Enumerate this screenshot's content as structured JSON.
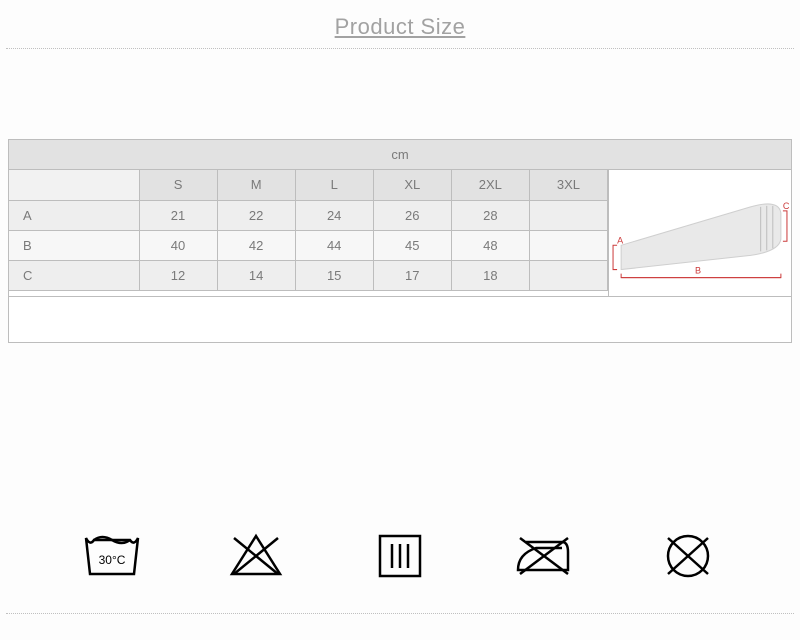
{
  "title": "Product Size",
  "unit": "cm",
  "chart_data": {
    "type": "table",
    "title": "Product Size (cm)",
    "columns": [
      "S",
      "M",
      "L",
      "XL",
      "2XL",
      "3XL"
    ],
    "rows": [
      {
        "label": "A",
        "values": [
          "21",
          "22",
          "24",
          "26",
          "28",
          ""
        ]
      },
      {
        "label": "B",
        "values": [
          "40",
          "42",
          "44",
          "45",
          "48",
          ""
        ]
      },
      {
        "label": "C",
        "values": [
          "12",
          "14",
          "15",
          "17",
          "18",
          ""
        ]
      }
    ]
  },
  "diagram": {
    "labels": {
      "a": "A",
      "b": "B",
      "c": "C"
    }
  },
  "care_icons": [
    "wash-30-icon",
    "do-not-bleach-icon",
    "tumble-dry-icon",
    "do-not-iron-icon",
    "do-not-dry-clean-icon"
  ],
  "wash_temp": "30°C"
}
